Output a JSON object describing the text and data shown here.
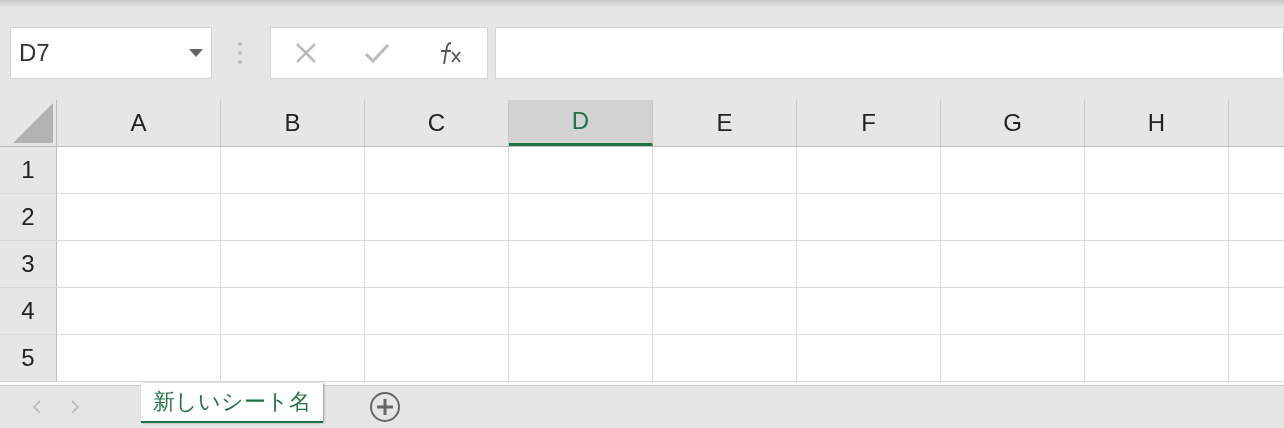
{
  "name_box": {
    "value": "D7"
  },
  "columns": [
    {
      "label": "A",
      "selected": false
    },
    {
      "label": "B",
      "selected": false
    },
    {
      "label": "C",
      "selected": false
    },
    {
      "label": "D",
      "selected": true
    },
    {
      "label": "E",
      "selected": false
    },
    {
      "label": "F",
      "selected": false
    },
    {
      "label": "G",
      "selected": false
    },
    {
      "label": "H",
      "selected": false
    }
  ],
  "rows": [
    "1",
    "2",
    "3",
    "4",
    "5"
  ],
  "sheet_tabs": [
    {
      "label": "新しいシート名",
      "selected": true
    }
  ]
}
